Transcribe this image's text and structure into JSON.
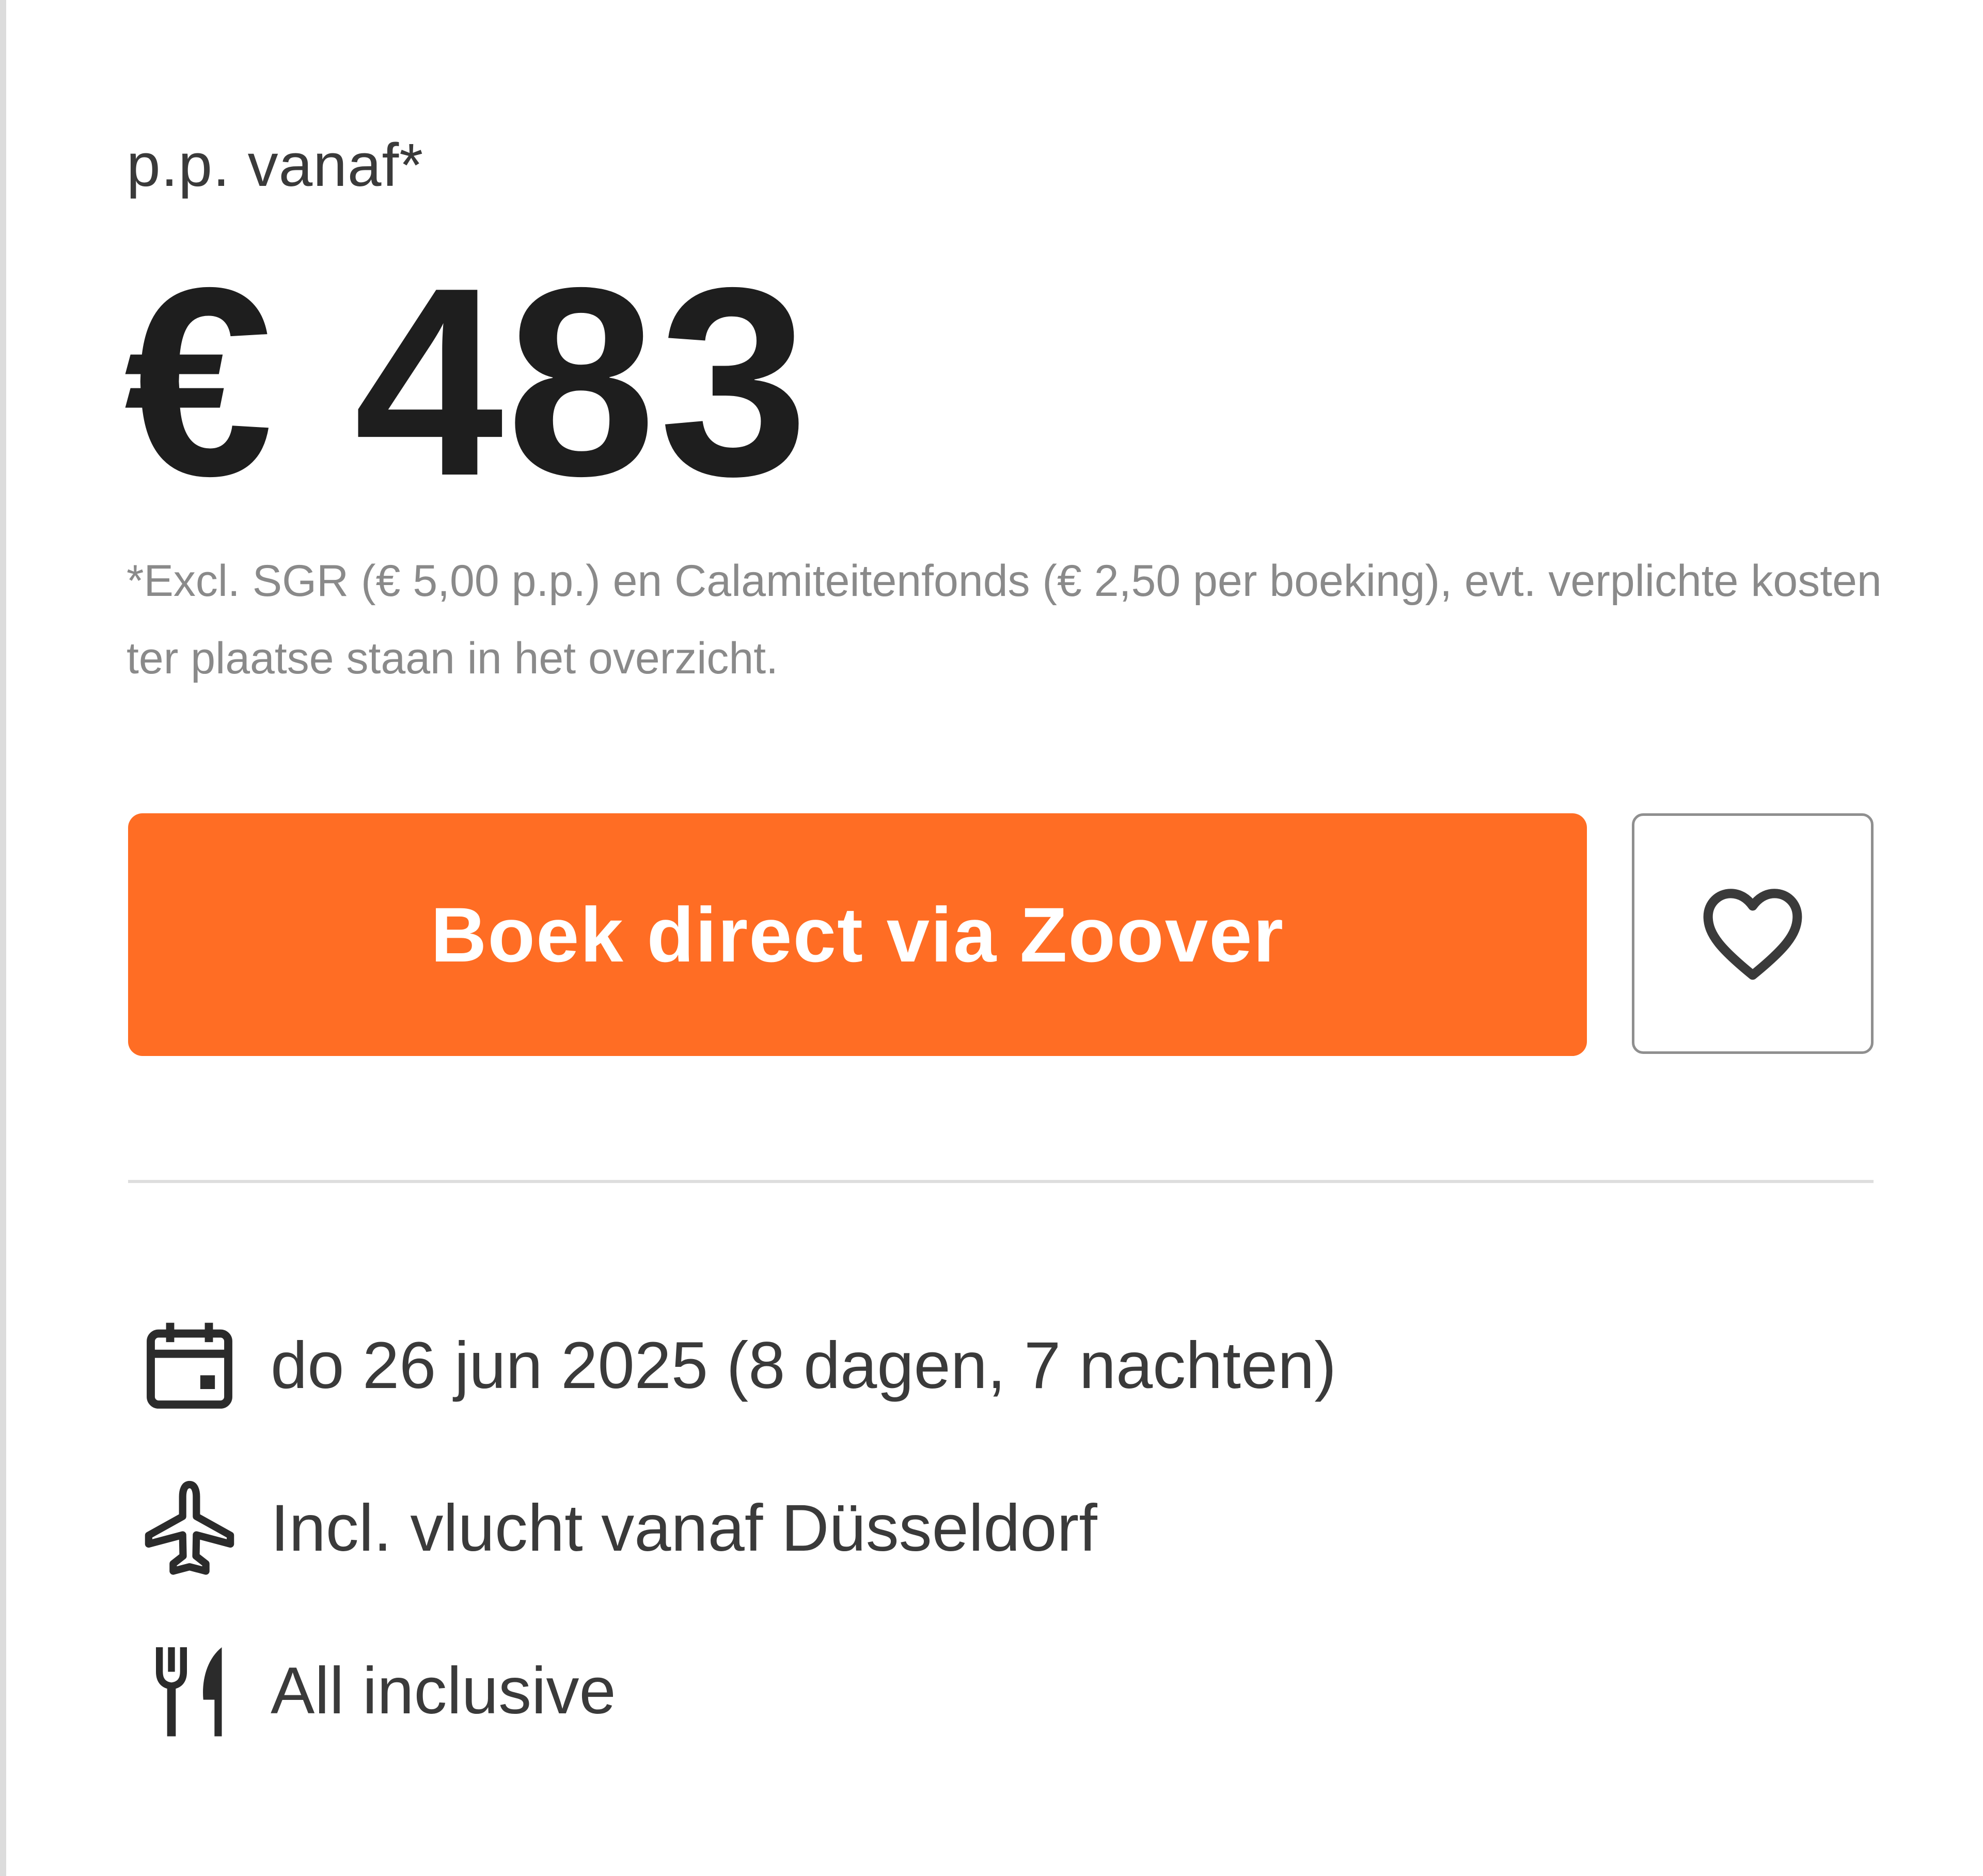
{
  "offer": {
    "price_label": "p.p. vanaf*",
    "price": "€ 483",
    "disclaimer": "*Excl. SGR (€ 5,00 p.p.) en Calamiteitenfonds (€ 2,50 per boeking), evt. verplichte kosten ter plaatse staan in het overzicht."
  },
  "actions": {
    "book_label": "Boek direct via Zoover",
    "favorite_icon": "heart-icon"
  },
  "details": {
    "date": {
      "icon": "calendar-icon",
      "text": "do 26 jun 2025 (8 dagen, 7 nachten)"
    },
    "flight": {
      "icon": "airplane-icon",
      "text": "Incl. vlucht vanaf Düsseldorf"
    },
    "board": {
      "icon": "cutlery-icon",
      "text": "All inclusive"
    }
  },
  "colors": {
    "accent": "#ff6d24",
    "text": "#3a3a3a",
    "muted": "#8a8a8a",
    "price": "#1e1e1e"
  }
}
